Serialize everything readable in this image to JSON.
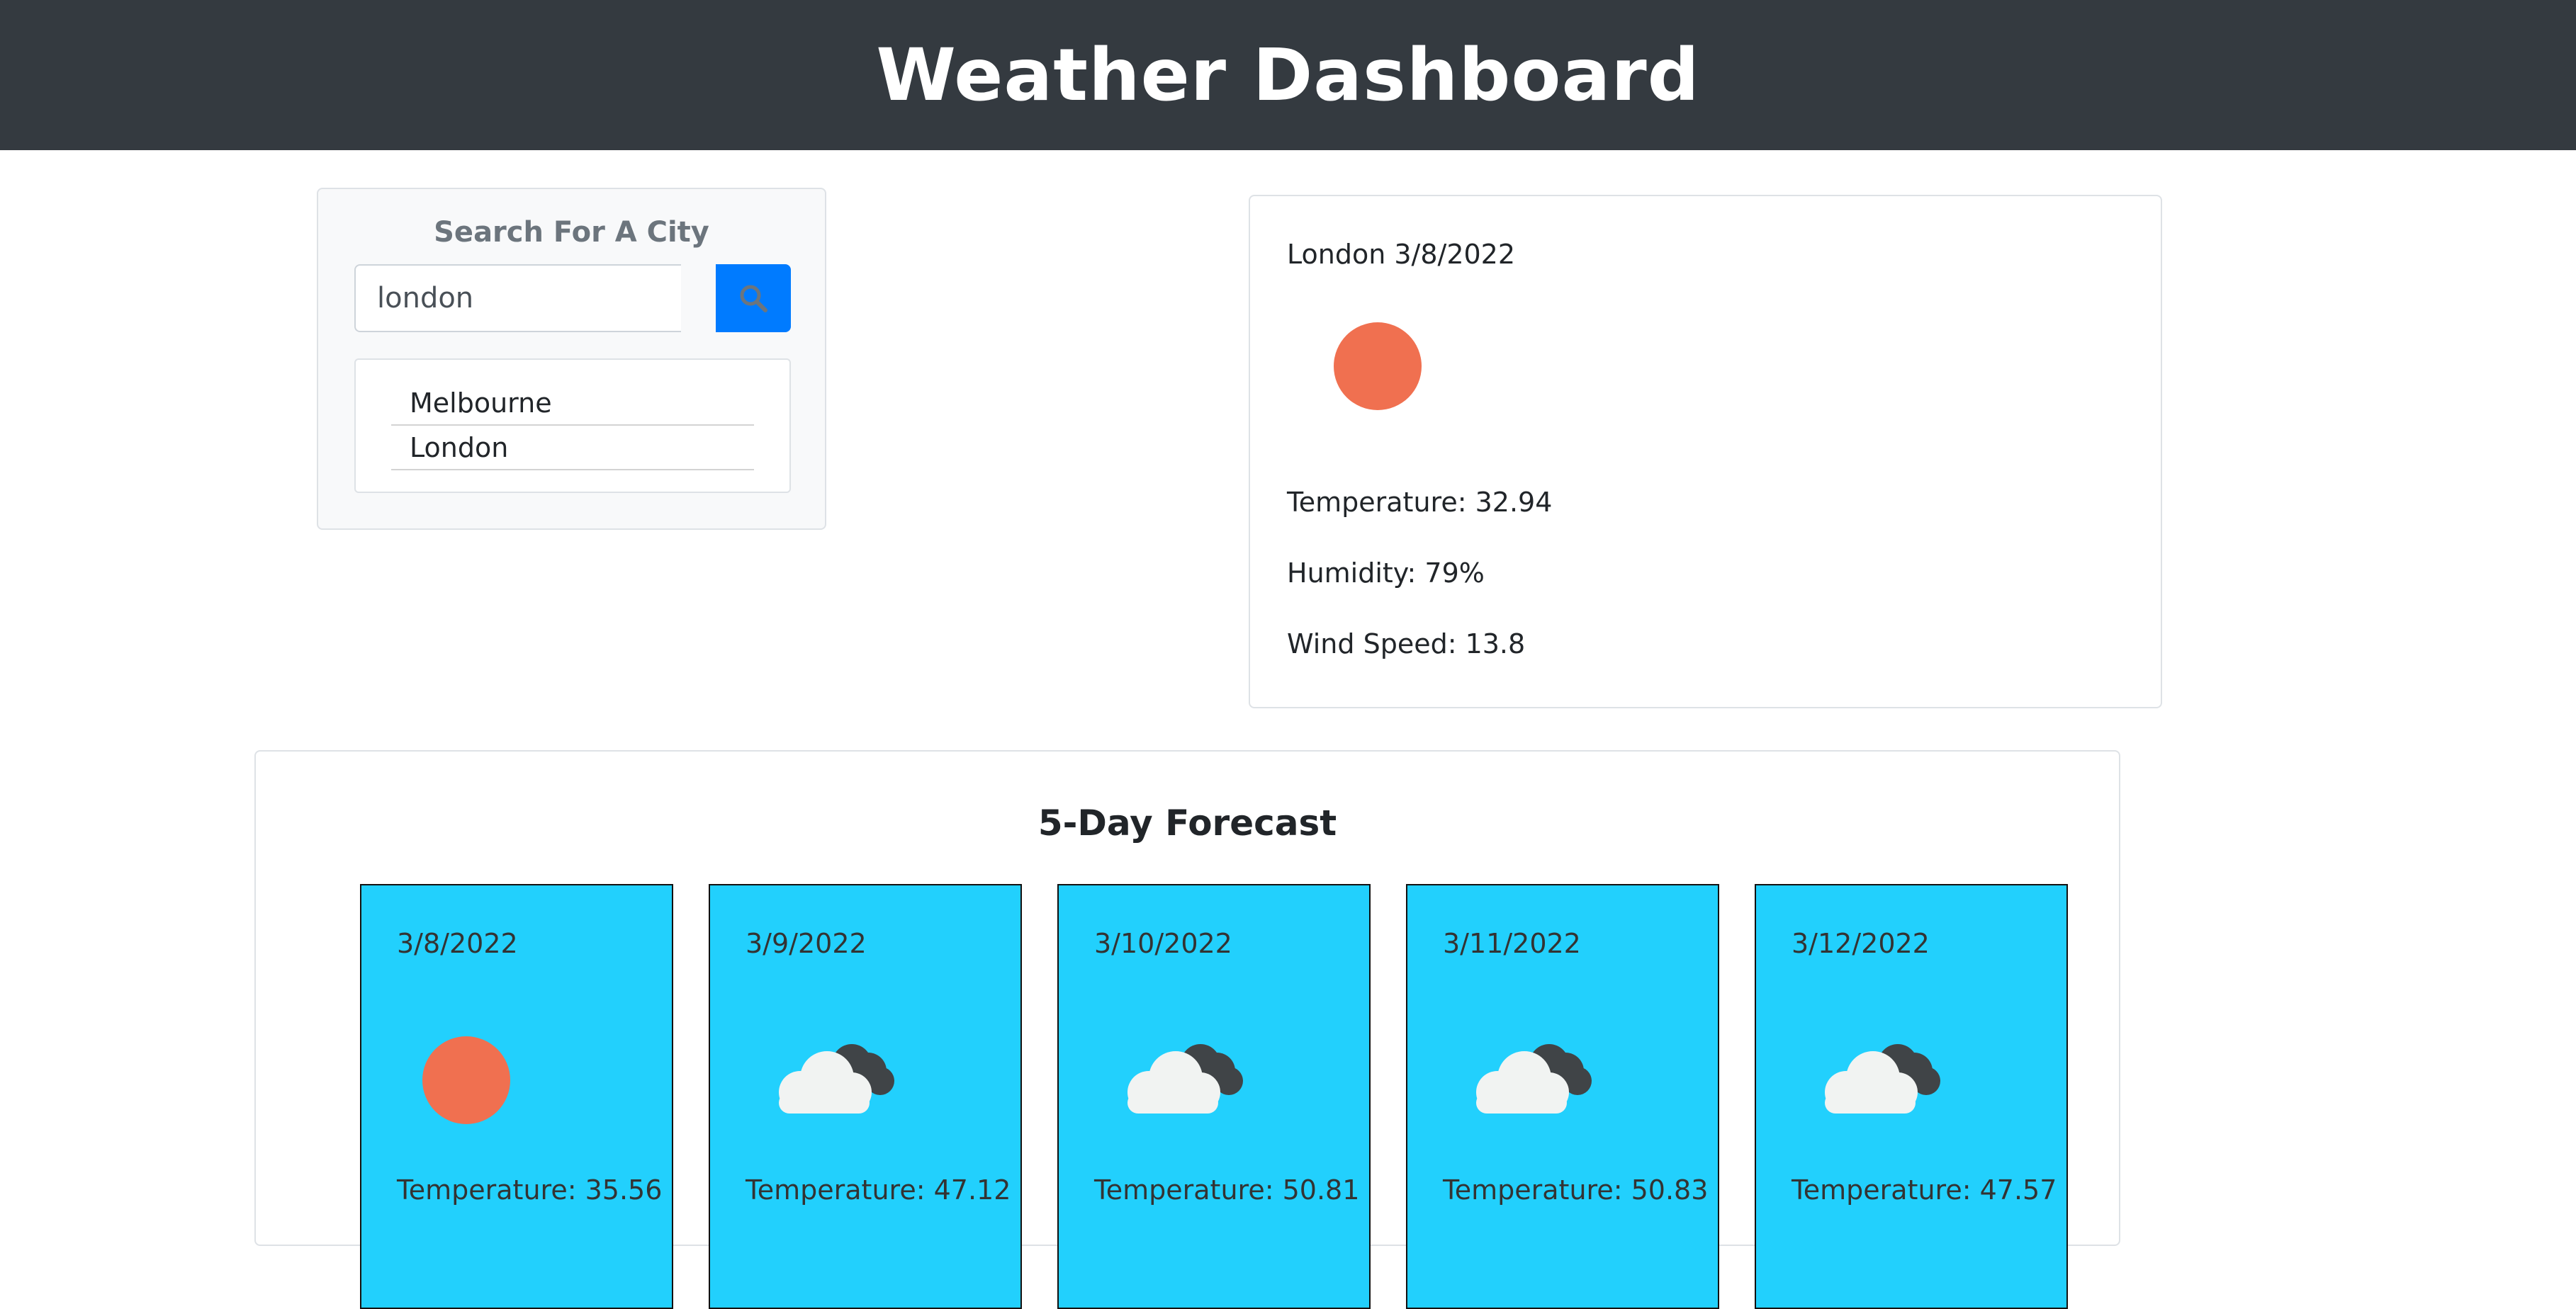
{
  "header": {
    "title": "Weather Dashboard"
  },
  "search": {
    "title": "Search For A City",
    "input_value": "london",
    "button_icon": "search-icon",
    "history": [
      "Melbourne",
      "London"
    ]
  },
  "current": {
    "title": "London 3/8/2022",
    "icon": "sun-icon",
    "temperature": "Temperature: 32.94",
    "humidity": "Humidity: 79%",
    "wind": "Wind Speed: 13.8"
  },
  "forecast": {
    "title": "5-Day Forecast",
    "days": [
      {
        "date": "3/8/2022",
        "icon": "sun-icon",
        "temperature": "Temperature: 35.56"
      },
      {
        "date": "3/9/2022",
        "icon": "cloud-icon",
        "temperature": "Temperature: 47.12"
      },
      {
        "date": "3/10/2022",
        "icon": "cloud-icon",
        "temperature": "Temperature: 50.81"
      },
      {
        "date": "3/11/2022",
        "icon": "cloud-icon",
        "temperature": "Temperature: 50.83"
      },
      {
        "date": "3/12/2022",
        "icon": "cloud-icon",
        "temperature": "Temperature: 47.57"
      }
    ]
  },
  "colors": {
    "header_bg": "#343a40",
    "accent": "#007bff",
    "forecast_card": "#22d0fd",
    "sun": "#f07050"
  }
}
